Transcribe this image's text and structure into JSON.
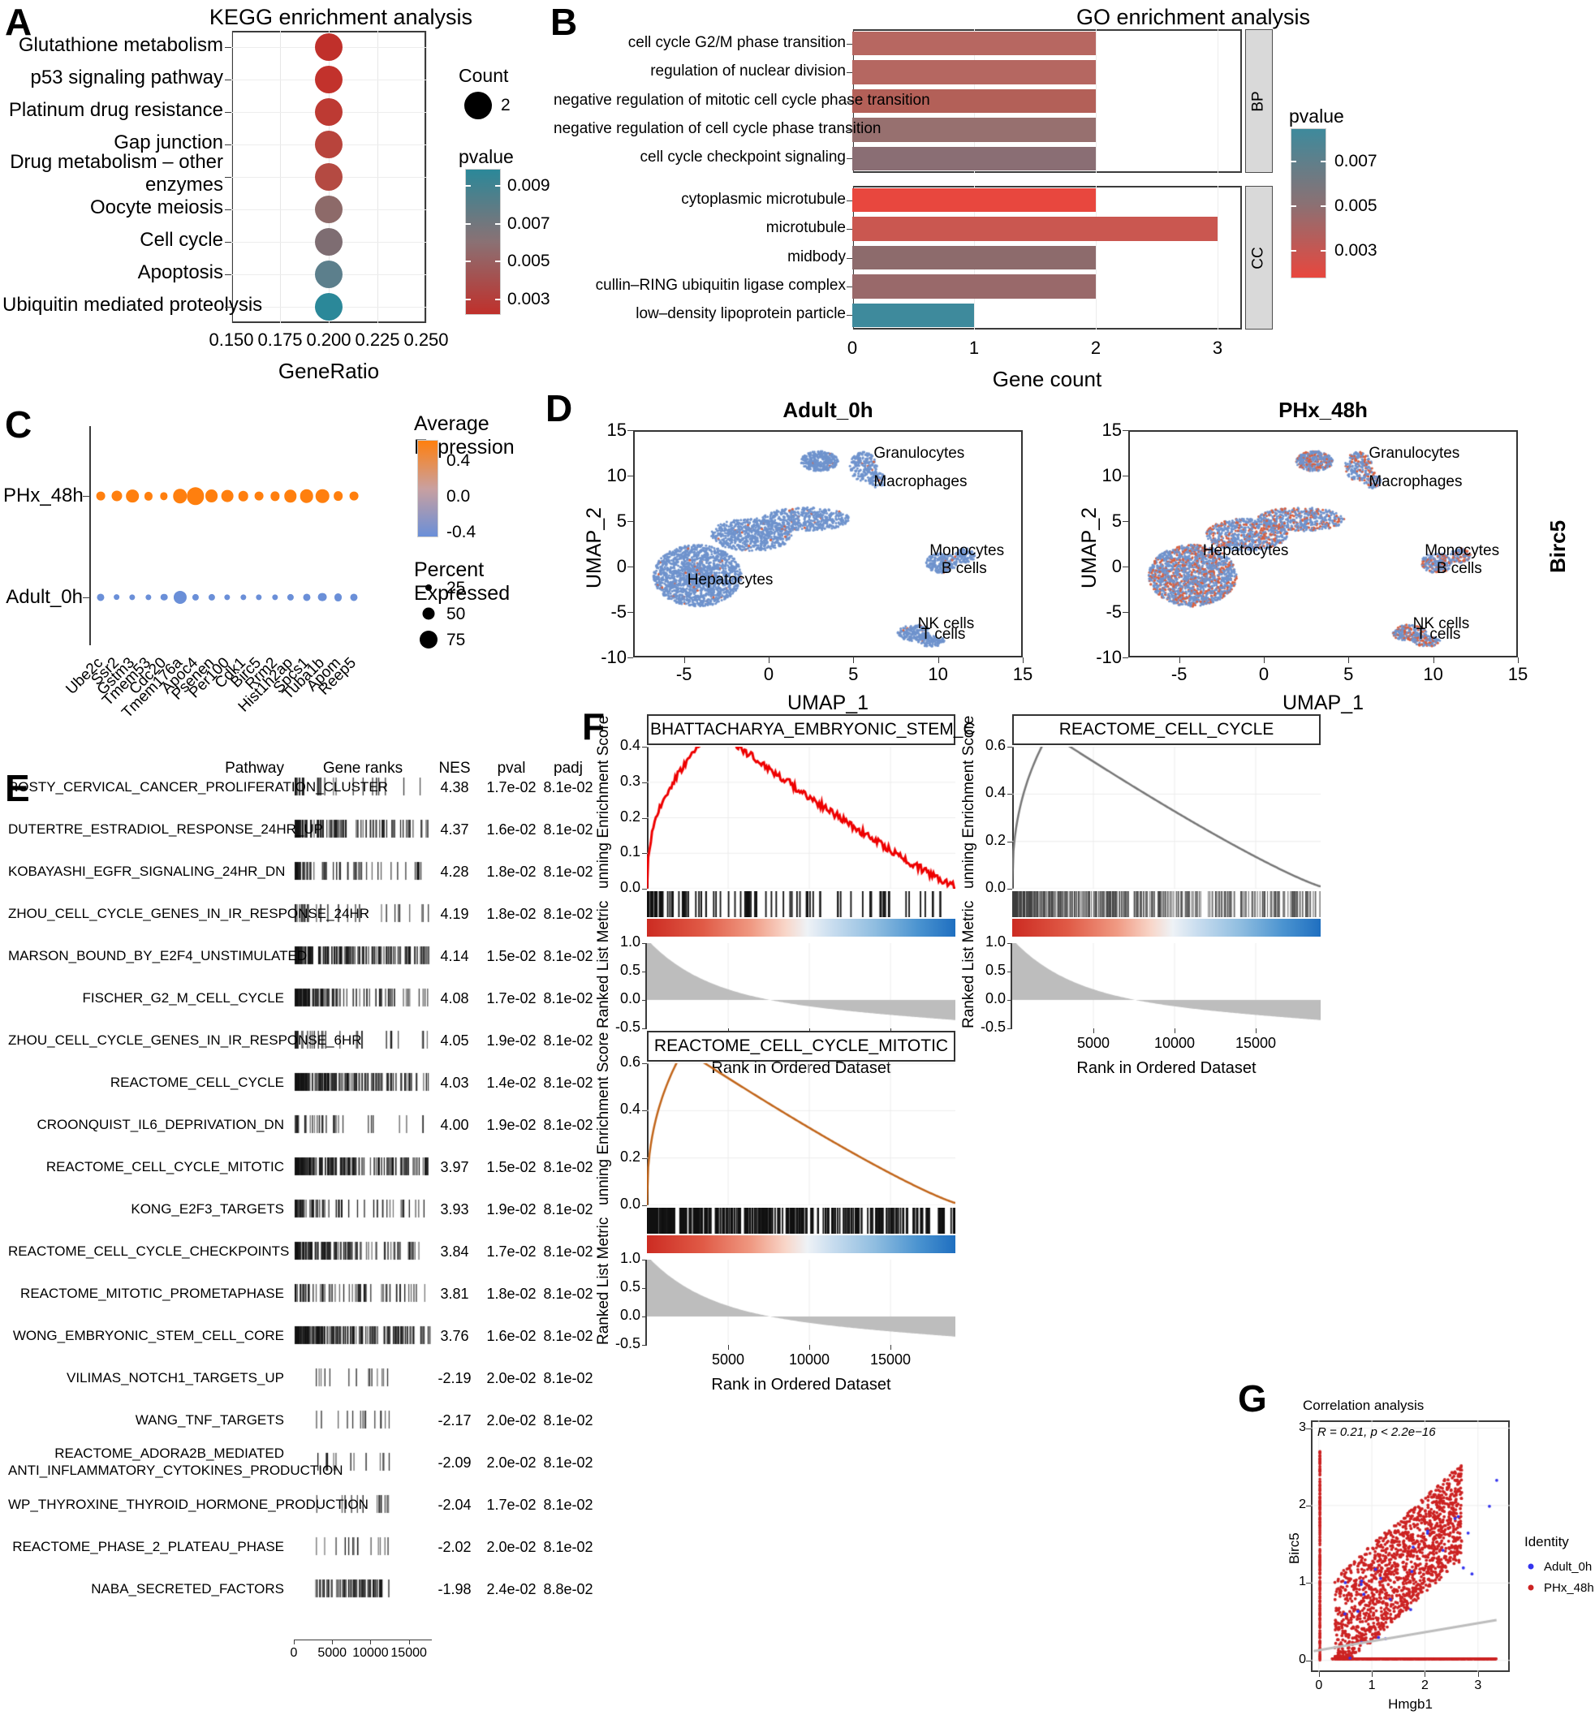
{
  "panels": {
    "A": {
      "letter": "A",
      "title": "KEGG enrichment analysis"
    },
    "B": {
      "letter": "B",
      "title": "GO enrichment analysis"
    },
    "C": {
      "letter": "C"
    },
    "D": {
      "letter": "D"
    },
    "E": {
      "letter": "E"
    },
    "F": {
      "letter": "F"
    },
    "G": {
      "letter": "G",
      "title": "Correlation analysis"
    }
  },
  "chart_data": [
    {
      "id": "kegg",
      "type": "scatter",
      "title": "KEGG enrichment analysis",
      "xlabel": "GeneRatio",
      "ylabel": "",
      "xlim": [
        0.15,
        0.25
      ],
      "xticks": [
        "0.150",
        "0.175",
        "0.200",
        "0.225",
        "0.250"
      ],
      "xtickvals": [
        0.15,
        0.175,
        0.2,
        0.225,
        0.25
      ],
      "grid": true,
      "categories": [
        "Glutathione metabolism",
        "p53 signaling pathway",
        "Platinum drug resistance",
        "Gap junction",
        "Drug metabolism – other enzymes",
        "Oocyte meiosis",
        "Cell cycle",
        "Apoptosis",
        "Ubiquitin mediated proteolysis"
      ],
      "points": [
        {
          "category": "Glutathione metabolism",
          "generatio": 0.2,
          "count": 2,
          "pvalue": 0.0028,
          "color": "#c0302b"
        },
        {
          "category": "p53 signaling pathway",
          "generatio": 0.2,
          "count": 2,
          "pvalue": 0.003,
          "color": "#c2322c"
        },
        {
          "category": "Platinum drug resistance",
          "generatio": 0.2,
          "count": 2,
          "pvalue": 0.0034,
          "color": "#bd3a33"
        },
        {
          "category": "Gap junction",
          "generatio": 0.2,
          "count": 2,
          "pvalue": 0.004,
          "color": "#b8443c"
        },
        {
          "category": "Drug metabolism – other enzymes",
          "generatio": 0.2,
          "count": 2,
          "pvalue": 0.0043,
          "color": "#b44a42"
        },
        {
          "category": "Oocyte meiosis",
          "generatio": 0.2,
          "count": 2,
          "pvalue": 0.006,
          "color": "#8d6a69"
        },
        {
          "category": "Cell cycle",
          "generatio": 0.2,
          "count": 2,
          "pvalue": 0.0066,
          "color": "#7e6d72"
        },
        {
          "category": "Apoptosis",
          "generatio": 0.2,
          "count": 2,
          "pvalue": 0.008,
          "color": "#5c7f8c"
        },
        {
          "category": "Ubiquitin mediated proteolysis",
          "generatio": 0.2,
          "count": 2,
          "pvalue": 0.0092,
          "color": "#2b8899"
        }
      ],
      "legend": {
        "count_title": "Count",
        "count_values": [
          "2"
        ],
        "pvalue_title": "pvalue",
        "pvalue_ticks": [
          "0.009",
          "0.007",
          "0.005",
          "0.003"
        ],
        "pvalue_high_color": "#2b8899",
        "pvalue_low_color": "#c0302b"
      }
    },
    {
      "id": "go",
      "type": "bar",
      "title": "GO enrichment analysis",
      "xlabel": "Gene count",
      "xlim": [
        0,
        3.2
      ],
      "xticks": [
        "0",
        "1",
        "2",
        "3"
      ],
      "xtickvals": [
        0,
        1,
        2,
        3
      ],
      "facets": [
        {
          "name": "BP",
          "categories": [
            "cell cycle G2/M phase transition",
            "regulation of nuclear division",
            "negative regulation of mitotic cell cycle phase transition",
            "negative regulation of cell cycle phase transition",
            "cell cycle checkpoint signaling"
          ],
          "values": [
            2,
            2,
            2,
            2,
            2
          ],
          "pvalues": [
            0.0035,
            0.0036,
            0.004,
            0.005,
            0.0058
          ],
          "colors": [
            "#b76761",
            "#b56761",
            "#b36058",
            "#97706f",
            "#8a6e74"
          ]
        },
        {
          "name": "CC",
          "categories": [
            "cytoplasmic microtubule",
            "microtubule",
            "midbody",
            "cullin–RING ubiquitin ligase complex",
            "low–density lipoprotein particle"
          ],
          "values": [
            2,
            3,
            2,
            2,
            1
          ],
          "pvalues": [
            0.0025,
            0.0031,
            0.005,
            0.0046,
            0.0085
          ],
          "colors": [
            "#e8473e",
            "#ca5750",
            "#8d6b6c",
            "#99696a",
            "#3e8a9c"
          ]
        }
      ],
      "legend": {
        "pvalue_title": "pvalue",
        "pvalue_ticks": [
          "0.007",
          "0.005",
          "0.003"
        ],
        "pvalue_high_color": "#3e8a9c",
        "pvalue_low_color": "#e8473e"
      }
    },
    {
      "id": "dotplot",
      "type": "scatter",
      "title": "",
      "groups": [
        "PHx_48h",
        "Adult_0h"
      ],
      "genes": [
        "Ube2c",
        "Ssr2",
        "Gstm3",
        "Tmem53",
        "Cdc20",
        "Tmem176a",
        "Apoc4",
        "Psenen",
        "Per100",
        "Cdk1",
        "Birc5",
        "Rrm2",
        "Hist1h2ap",
        "Spcs1",
        "Tuba1b",
        "Apom",
        "Reep5"
      ],
      "series": [
        {
          "name": "PHx_48h",
          "avg_expression": [
            0.45,
            0.45,
            0.48,
            0.42,
            0.4,
            0.55,
            0.58,
            0.5,
            0.48,
            0.42,
            0.4,
            0.46,
            0.5,
            0.52,
            0.52,
            0.44,
            0.42
          ],
          "percent_expressed": [
            22,
            32,
            44,
            19,
            15,
            52,
            70,
            45,
            40,
            30,
            22,
            24,
            43,
            48,
            48,
            26,
            22
          ]
        },
        {
          "name": "Adult_0h",
          "avg_expression": [
            -0.45,
            -0.45,
            -0.48,
            -0.42,
            -0.4,
            -0.55,
            -0.58,
            -0.5,
            -0.48,
            -0.42,
            -0.4,
            -0.46,
            -0.5,
            -0.52,
            -0.52,
            -0.44,
            -0.42
          ],
          "percent_expressed": [
            14,
            8,
            6,
            6,
            12,
            46,
            10,
            10,
            6,
            6,
            6,
            6,
            10,
            14,
            22,
            18,
            14
          ]
        }
      ],
      "legend": {
        "color_title": "Average Expression",
        "color_ticks": [
          "0.4",
          "0.0",
          "-0.4"
        ],
        "high_color": "#ff7f0e",
        "low_color": "#6a8fd8",
        "size_title": "Percent Expressed",
        "size_ticks": [
          "25",
          "50",
          "75"
        ]
      }
    },
    {
      "id": "umap_adult",
      "type": "scatter",
      "title": "Adult_0h",
      "xlabel": "UMAP_1",
      "ylabel": "UMAP_2",
      "xlim": [
        -8,
        15
      ],
      "ylim": [
        -10,
        15
      ],
      "xticks": [
        "-5",
        "0",
        "5",
        "10",
        "15"
      ],
      "xtickvals": [
        -5,
        0,
        5,
        10,
        15
      ],
      "yticks": [
        "-10",
        "-5",
        "0",
        "5",
        "10",
        "15"
      ],
      "ytickvals": [
        -10,
        -5,
        0,
        5,
        10,
        15
      ],
      "annotations": [
        {
          "label": "Granulocytes",
          "x": 6.2,
          "y": 12.3
        },
        {
          "label": "Macrophages",
          "x": 6.2,
          "y": 9.2
        },
        {
          "label": "Monocytes",
          "x": 9.5,
          "y": 1.6
        },
        {
          "label": "B cells",
          "x": 10.2,
          "y": -0.4
        },
        {
          "label": "NK cells",
          "x": 8.8,
          "y": -6.4
        },
        {
          "label": "T cells",
          "x": 9.0,
          "y": -7.6
        },
        {
          "label": "Hepatocytes",
          "x": -4.8,
          "y": -1.6
        }
      ]
    },
    {
      "id": "umap_phx",
      "type": "scatter",
      "title": "PHx_48h",
      "xlabel": "UMAP_1",
      "ylabel": "UMAP_2",
      "side_label": "Birc5",
      "xlim": [
        -8,
        15
      ],
      "ylim": [
        -10,
        15
      ],
      "xticks": [
        "-5",
        "0",
        "5",
        "10",
        "15"
      ],
      "xtickvals": [
        -5,
        0,
        5,
        10,
        15
      ],
      "yticks": [
        "-10",
        "-5",
        "0",
        "5",
        "10",
        "15"
      ],
      "ytickvals": [
        -10,
        -5,
        0,
        5,
        10,
        15
      ],
      "annotations": [
        {
          "label": "Granulocytes",
          "x": 6.2,
          "y": 12.3
        },
        {
          "label": "Macrophages",
          "x": 6.2,
          "y": 9.2
        },
        {
          "label": "Monocytes",
          "x": 9.5,
          "y": 1.6
        },
        {
          "label": "B cells",
          "x": 10.2,
          "y": -0.4
        },
        {
          "label": "NK cells",
          "x": 8.8,
          "y": -6.4
        },
        {
          "label": "T cells",
          "x": 9.0,
          "y": -7.6
        },
        {
          "label": "Hepatocytes",
          "x": -3.6,
          "y": 1.6
        }
      ]
    },
    {
      "id": "fgsea_table",
      "type": "table",
      "columns": [
        "Pathway",
        "Gene ranks",
        "NES",
        "pval",
        "padj"
      ],
      "xaxis_ticks": [
        "0",
        "5000",
        "10000",
        "15000"
      ],
      "xaxis_tickvals": [
        0,
        5000,
        10000,
        15000
      ],
      "rows": [
        {
          "pathway": "ROSTY_CERVICAL_CANCER_PROLIFERATION_CLUSTER",
          "nes": "4.38",
          "pval": "1.7e-02",
          "padj": "8.1e-02",
          "density": "low"
        },
        {
          "pathway": "DUTERTRE_ESTRADIOL_RESPONSE_24HR_UP",
          "nes": "4.37",
          "pval": "1.6e-02",
          "padj": "8.1e-02",
          "density": "high"
        },
        {
          "pathway": "KOBAYASHI_EGFR_SIGNALING_24HR_DN",
          "nes": "4.28",
          "pval": "1.8e-02",
          "padj": "8.1e-02",
          "density": "med"
        },
        {
          "pathway": "ZHOU_CELL_CYCLE_GENES_IN_IR_RESPONSE_24HR",
          "nes": "4.19",
          "pval": "1.8e-02",
          "padj": "8.1e-02",
          "density": "low"
        },
        {
          "pathway": "MARSON_BOUND_BY_E2F4_UNSTIMULATED",
          "nes": "4.14",
          "pval": "1.5e-02",
          "padj": "8.1e-02",
          "density": "vhigh"
        },
        {
          "pathway": "FISCHER_G2_M_CELL_CYCLE",
          "nes": "4.08",
          "pval": "1.7e-02",
          "padj": "8.1e-02",
          "density": "high"
        },
        {
          "pathway": "ZHOU_CELL_CYCLE_GENES_IN_IR_RESPONSE_6HR",
          "nes": "4.05",
          "pval": "1.9e-02",
          "padj": "8.1e-02",
          "density": "low"
        },
        {
          "pathway": "REACTOME_CELL_CYCLE",
          "nes": "4.03",
          "pval": "1.4e-02",
          "padj": "8.1e-02",
          "density": "vhigh"
        },
        {
          "pathway": "CROONQUIST_IL6_DEPRIVATION_DN",
          "nes": "4.00",
          "pval": "1.9e-02",
          "padj": "8.1e-02",
          "density": "low"
        },
        {
          "pathway": "REACTOME_CELL_CYCLE_MITOTIC",
          "nes": "3.97",
          "pval": "1.5e-02",
          "padj": "8.1e-02",
          "density": "vhigh"
        },
        {
          "pathway": "KONG_E2F3_TARGETS",
          "nes": "3.93",
          "pval": "1.9e-02",
          "padj": "8.1e-02",
          "density": "med"
        },
        {
          "pathway": "REACTOME_CELL_CYCLE_CHECKPOINTS",
          "nes": "3.84",
          "pval": "1.7e-02",
          "padj": "8.1e-02",
          "density": "high"
        },
        {
          "pathway": "REACTOME_MITOTIC_PROMETAPHASE",
          "nes": "3.81",
          "pval": "1.8e-02",
          "padj": "8.1e-02",
          "density": "med"
        },
        {
          "pathway": "WONG_EMBRYONIC_STEM_CELL_CORE",
          "nes": "3.76",
          "pval": "1.6e-02",
          "padj": "8.1e-02",
          "density": "vhigh"
        },
        {
          "pathway": "VILIMAS_NOTCH1_TARGETS_UP",
          "nes": "-2.19",
          "pval": "2.0e-02",
          "padj": "8.1e-02",
          "density": "sparse"
        },
        {
          "pathway": "WANG_TNF_TARGETS",
          "nes": "-2.17",
          "pval": "2.0e-02",
          "padj": "8.1e-02",
          "density": "sparse"
        },
        {
          "pathway": "REACTOME_ADORA2B_MEDIATED ANTI_INFLAMMATORY_CYTOKINES_PRODUCTION",
          "nes": "-2.09",
          "pval": "2.0e-02",
          "padj": "8.1e-02",
          "density": "sparse"
        },
        {
          "pathway": "WP_THYROXINE_THYROID_HORMONE_PRODUCTION",
          "nes": "-2.04",
          "pval": "1.7e-02",
          "padj": "8.1e-02",
          "density": "sparse"
        },
        {
          "pathway": "REACTOME_PHASE_2_PLATEAU_PHASE",
          "nes": "-2.02",
          "pval": "2.0e-02",
          "padj": "8.1e-02",
          "density": "sparse"
        },
        {
          "pathway": "NABA_SECRETED_FACTORS",
          "nes": "-1.98",
          "pval": "2.4e-02",
          "padj": "8.8e-02",
          "density": "med"
        }
      ]
    },
    {
      "id": "gsea_bhattacharya",
      "type": "line",
      "title": "BHATTACHARYA_EMBRYONIC_STEM_C",
      "ylabel": "unning Enrichment Score",
      "ylabel2": "Ranked List Metric",
      "xlabel": "Rank in Ordered Dataset",
      "yticks": [
        "0.0",
        "0.1",
        "0.2",
        "0.3",
        "0.4"
      ],
      "ytickvals": [
        0.0,
        0.1,
        0.2,
        0.3,
        0.4
      ],
      "yticks2": [
        "-0.5",
        "0.0",
        "0.5",
        "1.0"
      ],
      "ytickvals2": [
        -0.5,
        0.0,
        0.5,
        1.0
      ],
      "xticks": [
        "5000",
        "10000",
        "15000"
      ],
      "xtickvals": [
        5000,
        10000,
        15000
      ],
      "xlim": [
        0,
        19000
      ],
      "line_color": "#ee0000",
      "peak": 0.45
    },
    {
      "id": "gsea_reactome_cc",
      "type": "line",
      "title": "REACTOME_CELL_CYCLE",
      "ylabel": "unning Enrichment Score",
      "ylabel2": "Ranked List Metric",
      "xlabel": "Rank in Ordered Dataset",
      "yticks": [
        "0.0",
        "0.2",
        "0.4",
        "0.6"
      ],
      "ytickvals": [
        0.0,
        0.2,
        0.4,
        0.6
      ],
      "yticks2": [
        "-0.5",
        "0.0",
        "0.5",
        "1.0"
      ],
      "ytickvals2": [
        -0.5,
        0.0,
        0.5,
        1.0
      ],
      "xticks": [
        "5000",
        "10000",
        "15000"
      ],
      "xtickvals": [
        5000,
        10000,
        15000
      ],
      "xlim": [
        0,
        19000
      ],
      "line_color": "#777777",
      "peak": 0.66
    },
    {
      "id": "gsea_reactome_ccm",
      "type": "line",
      "title": "REACTOME_CELL_CYCLE_MITOTIC",
      "ylabel": "unning Enrichment Score",
      "ylabel2": "Ranked List Metric",
      "xlabel": "Rank in Ordered Dataset",
      "yticks": [
        "0.0",
        "0.2",
        "0.4",
        "0.6"
      ],
      "ytickvals": [
        0.0,
        0.2,
        0.4,
        0.6
      ],
      "yticks2": [
        "-0.5",
        "0.0",
        "0.5",
        "1.0"
      ],
      "ytickvals2": [
        -0.5,
        0.0,
        0.5,
        1.0
      ],
      "xticks": [
        "5000",
        "10000",
        "15000"
      ],
      "xtickvals": [
        5000,
        10000,
        15000
      ],
      "xlim": [
        0,
        19000
      ],
      "line_color": "#c1651a",
      "peak": 0.66
    },
    {
      "id": "correlation",
      "type": "scatter",
      "title": "Correlation analysis",
      "xlabel": "Hmgb1",
      "ylabel": "Birc5",
      "annotation": "R = 0.21, p < 2.2e−16",
      "r_value": "0.21",
      "p_value": "p < 2.2e−16",
      "xlim": [
        -0.15,
        3.6
      ],
      "ylim": [
        -0.15,
        3.1
      ],
      "xticks": [
        "0",
        "1",
        "2",
        "3"
      ],
      "xtickvals": [
        0,
        1,
        2,
        3
      ],
      "yticks": [
        "0",
        "1",
        "2",
        "3"
      ],
      "ytickvals": [
        0,
        1,
        2,
        3
      ],
      "legend": {
        "title": "Identity",
        "items": [
          {
            "label": "Adult_0h",
            "color": "#3333ee"
          },
          {
            "label": "PHx_48h",
            "color": "#cc2222"
          }
        ]
      }
    }
  ]
}
